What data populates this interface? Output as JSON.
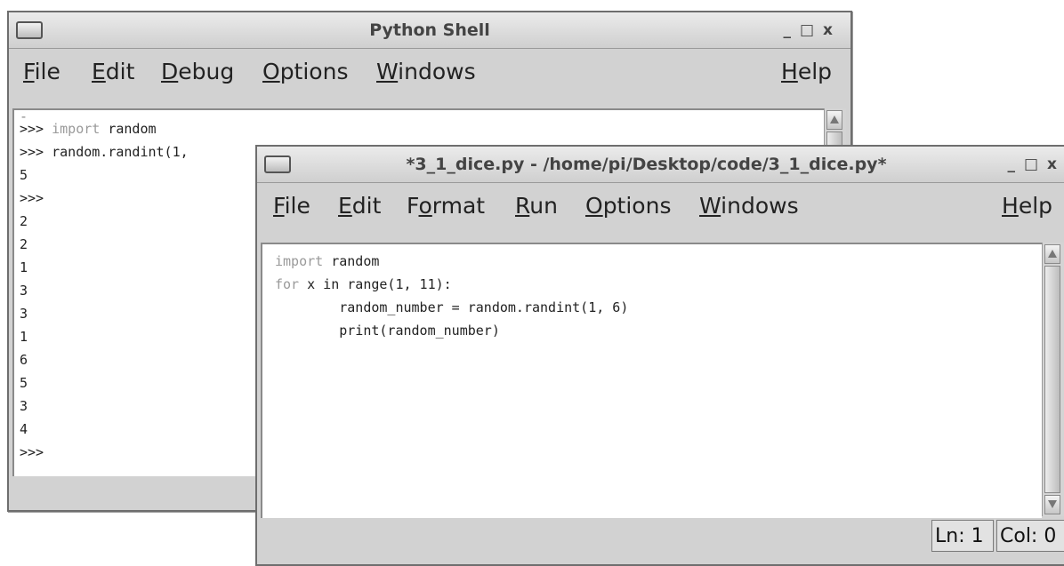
{
  "shell": {
    "title": "Python Shell",
    "menu": [
      {
        "pre": "",
        "ul": "F",
        "post": "ile"
      },
      {
        "pre": "",
        "ul": "E",
        "post": "dit"
      },
      {
        "pre": "",
        "ul": "D",
        "post": "ebug"
      },
      {
        "pre": "",
        "ul": "O",
        "post": "ptions"
      },
      {
        "pre": "",
        "ul": "W",
        "post": "indows"
      },
      {
        "pre": "",
        "ul": "H",
        "post": "elp"
      }
    ],
    "lines": [
      ">>> import random",
      ">>> random.randint(1,",
      "5",
      ">>>",
      "2",
      "2",
      "1",
      "3",
      "3",
      "1",
      "6",
      "5",
      "3",
      "4",
      ">>>"
    ],
    "controls": {
      "min": "_",
      "max": "□",
      "close": "x"
    }
  },
  "editor": {
    "title": "*3_1_dice.py - /home/pi/Desktop/code/3_1_dice.py*",
    "menu": [
      {
        "pre": "",
        "ul": "F",
        "post": "ile"
      },
      {
        "pre": "",
        "ul": "E",
        "post": "dit"
      },
      {
        "pre": "F",
        "ul": "o",
        "post": "rmat"
      },
      {
        "pre": "",
        "ul": "R",
        "post": "un"
      },
      {
        "pre": "",
        "ul": "O",
        "post": "ptions"
      },
      {
        "pre": "",
        "ul": "W",
        "post": "indows"
      },
      {
        "pre": "",
        "ul": "H",
        "post": "elp"
      }
    ],
    "code": [
      {
        "kw": "import",
        "rest": " random",
        "indent": ""
      },
      {
        "kw": "for",
        "rest": " x in range(1, 11):",
        "indent": ""
      },
      {
        "kw": "",
        "rest": "random_number = random.randint(1, 6)",
        "indent": "        "
      },
      {
        "kw": "",
        "rest": "print(random_number)",
        "indent": "        "
      }
    ],
    "status": {
      "line": "Ln: 1",
      "col": "Col: 0"
    },
    "controls": {
      "min": "_",
      "max": "□",
      "close": "x"
    }
  }
}
